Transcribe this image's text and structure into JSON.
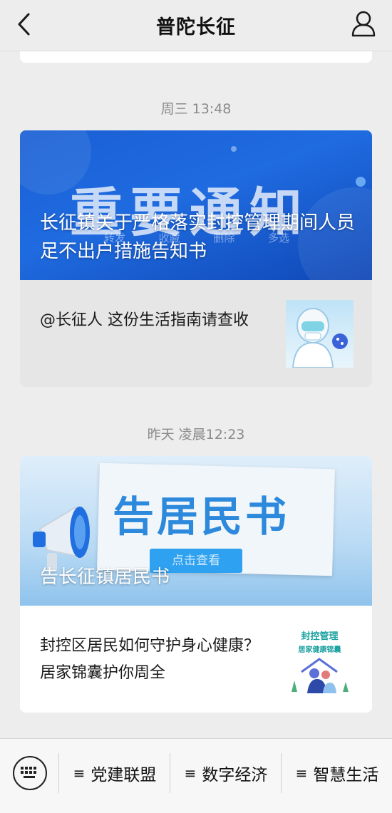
{
  "header": {
    "title": "普陀长征",
    "back_icon": "chevron-left-icon",
    "profile_icon": "person-icon"
  },
  "messages": [
    {
      "time": "周三 13:48",
      "cover_title": "长征镇关于严格落实封控管理期间人员足不出户措施告知书",
      "cover_big_text": "重要通知",
      "cover_overlay_menu": [
        "转发",
        "收藏",
        "删除",
        "多选"
      ],
      "sub_title": "@长征人 这份生活指南请查收"
    },
    {
      "time": "昨天 凌晨12:23",
      "cover_title": "告长征镇居民书",
      "cover_big_text": "告居民书",
      "cover_button": "点击查看",
      "sub_title": "封控区居民如何守护身心健康？居家锦囊护你周全",
      "thumb_line1": "封控管理",
      "thumb_line2": "居家健康锦囊"
    }
  ],
  "bottom_menu": {
    "keyboard_icon": "keyboard-icon",
    "items": [
      "党建联盟",
      "数字经济",
      "智慧生活"
    ],
    "item_icon": "≡"
  },
  "colors": {
    "background": "#ededed",
    "card": "#ffffff",
    "card_selected": "#e6e6e6",
    "accent_blue": "#1f6be0"
  }
}
